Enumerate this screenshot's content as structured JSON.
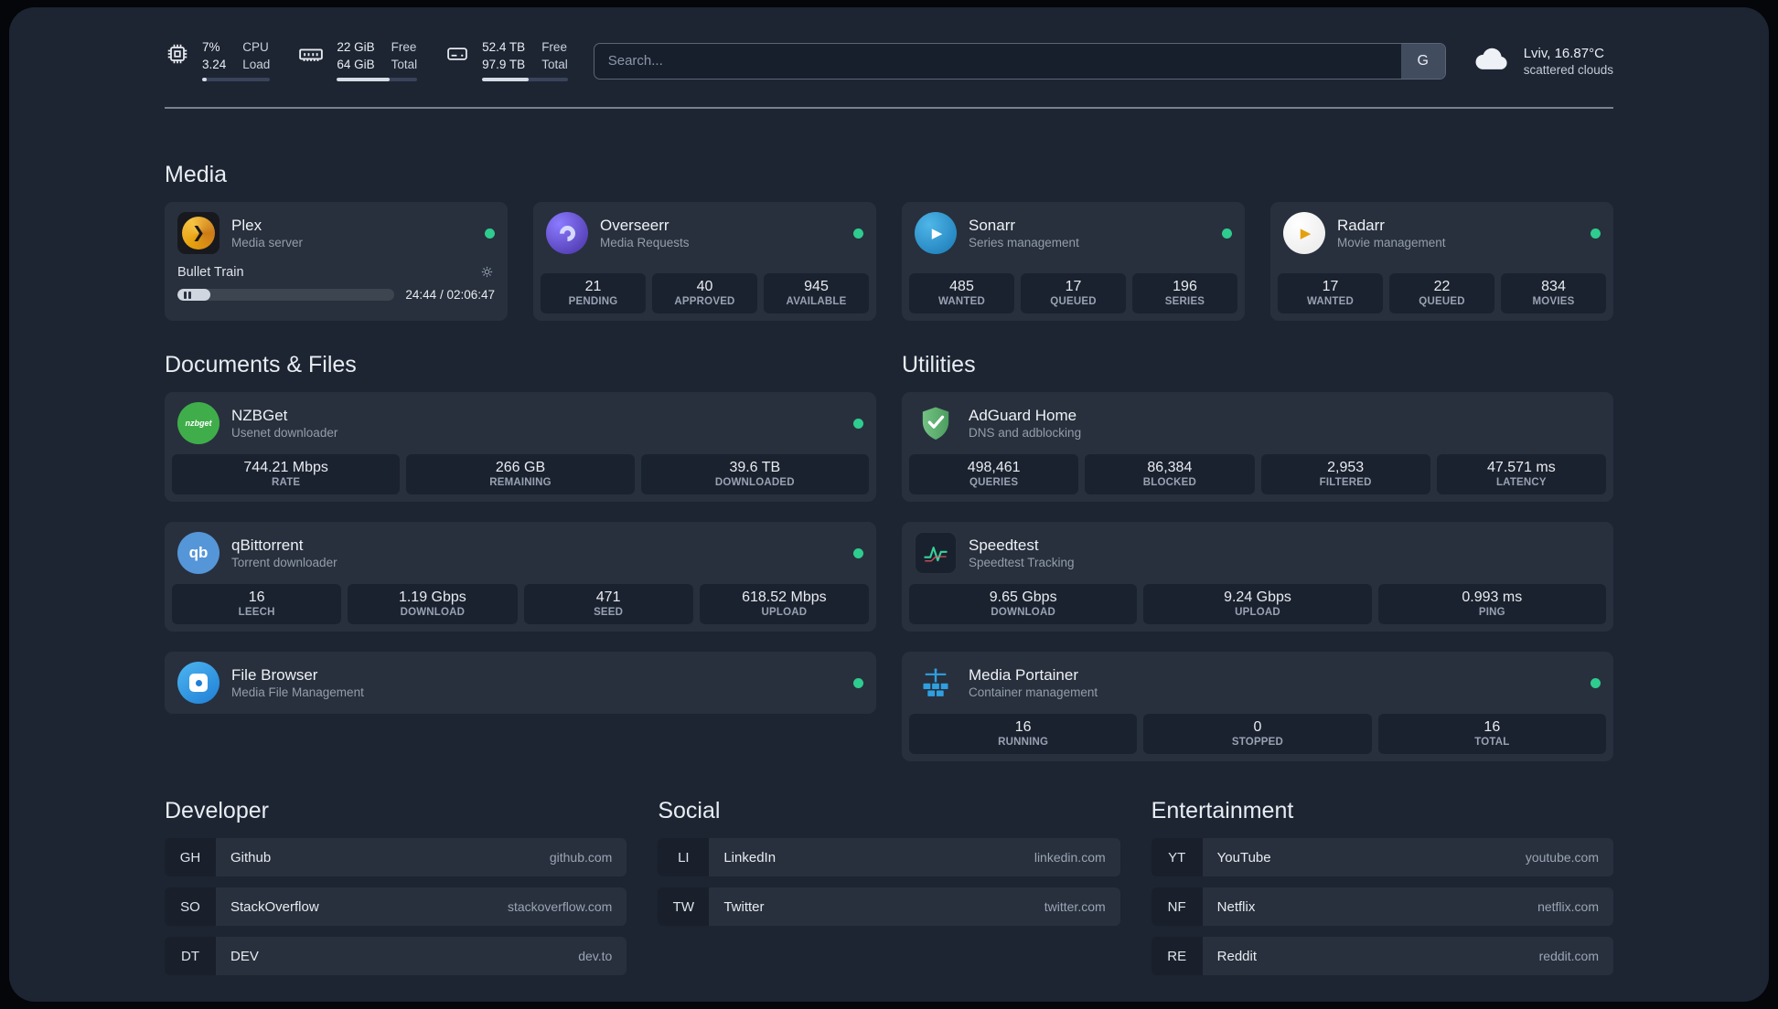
{
  "theme": {
    "background": "#1d2533",
    "card_background": "rgba(255,255,255,0.05)",
    "status_online_color": "#2ecc8f",
    "bar_fill_color": "#d7dde6",
    "text_primary": "#e9edf3",
    "text_muted": "#949dab"
  },
  "icons": {
    "plex_chevron": "❯",
    "sonarr_play": "▶",
    "radarr_play": "▶",
    "qbittorrent_glyph": "qb",
    "nzbget_glyph": "nzbget"
  },
  "topbar": {
    "cpu": {
      "value1": "7%",
      "value2": "3.24",
      "label1": "CPU",
      "label2": "Load",
      "bar_percent": 7
    },
    "memory": {
      "value1": "22 GiB",
      "value2": "64 GiB",
      "label1": "Free",
      "label2": "Total",
      "bar_percent": 66
    },
    "disk": {
      "value1": "52.4 TB",
      "value2": "97.9 TB",
      "label1": "Free",
      "label2": "Total",
      "bar_percent": 54
    },
    "search": {
      "placeholder": "Search...",
      "provider_label": "G"
    },
    "weather": {
      "location": "Lviv, 16.87°C",
      "condition": "scattered clouds"
    }
  },
  "sections": {
    "media": "Media",
    "documents": "Documents & Files",
    "utilities": "Utilities"
  },
  "services": {
    "plex": {
      "name": "Plex",
      "desc": "Media server",
      "now_playing": "Bullet Train",
      "time": "24:44 / 02:06:47",
      "progress_percent": 15
    },
    "overseerr": {
      "name": "Overseerr",
      "desc": "Media Requests",
      "stats": [
        {
          "value": "21",
          "label": "PENDING"
        },
        {
          "value": "40",
          "label": "APPROVED"
        },
        {
          "value": "945",
          "label": "AVAILABLE"
        }
      ]
    },
    "sonarr": {
      "name": "Sonarr",
      "desc": "Series management",
      "stats": [
        {
          "value": "485",
          "label": "WANTED"
        },
        {
          "value": "17",
          "label": "QUEUED"
        },
        {
          "value": "196",
          "label": "SERIES"
        }
      ]
    },
    "radarr": {
      "name": "Radarr",
      "desc": "Movie management",
      "stats": [
        {
          "value": "17",
          "label": "WANTED"
        },
        {
          "value": "22",
          "label": "QUEUED"
        },
        {
          "value": "834",
          "label": "MOVIES"
        }
      ]
    },
    "nzbget": {
      "name": "NZBGet",
      "desc": "Usenet downloader",
      "stats": [
        {
          "value": "744.21 Mbps",
          "label": "RATE"
        },
        {
          "value": "266 GB",
          "label": "REMAINING"
        },
        {
          "value": "39.6 TB",
          "label": "DOWNLOADED"
        }
      ]
    },
    "qbittorrent": {
      "name": "qBittorrent",
      "desc": "Torrent downloader",
      "stats": [
        {
          "value": "16",
          "label": "LEECH"
        },
        {
          "value": "1.19 Gbps",
          "label": "DOWNLOAD"
        },
        {
          "value": "471",
          "label": "SEED"
        },
        {
          "value": "618.52 Mbps",
          "label": "UPLOAD"
        }
      ]
    },
    "filebrowser": {
      "name": "File Browser",
      "desc": "Media File Management"
    },
    "adguard": {
      "name": "AdGuard Home",
      "desc": "DNS and adblocking",
      "stats": [
        {
          "value": "498,461",
          "label": "QUERIES"
        },
        {
          "value": "86,384",
          "label": "BLOCKED"
        },
        {
          "value": "2,953",
          "label": "FILTERED"
        },
        {
          "value": "47.571 ms",
          "label": "LATENCY"
        }
      ]
    },
    "speedtest": {
      "name": "Speedtest",
      "desc": "Speedtest Tracking",
      "stats": [
        {
          "value": "9.65 Gbps",
          "label": "DOWNLOAD"
        },
        {
          "value": "9.24 Gbps",
          "label": "UPLOAD"
        },
        {
          "value": "0.993 ms",
          "label": "PING"
        }
      ]
    },
    "portainer": {
      "name": "Media Portainer",
      "desc": "Container management",
      "stats": [
        {
          "value": "16",
          "label": "RUNNING"
        },
        {
          "value": "0",
          "label": "STOPPED"
        },
        {
          "value": "16",
          "label": "TOTAL"
        }
      ]
    }
  },
  "bookmarks": {
    "developer": {
      "title": "Developer",
      "items": [
        {
          "abbr": "GH",
          "name": "Github",
          "url": "github.com"
        },
        {
          "abbr": "SO",
          "name": "StackOverflow",
          "url": "stackoverflow.com"
        },
        {
          "abbr": "DT",
          "name": "DEV",
          "url": "dev.to"
        }
      ]
    },
    "social": {
      "title": "Social",
      "items": [
        {
          "abbr": "LI",
          "name": "LinkedIn",
          "url": "linkedin.com"
        },
        {
          "abbr": "TW",
          "name": "Twitter",
          "url": "twitter.com"
        }
      ]
    },
    "entertainment": {
      "title": "Entertainment",
      "items": [
        {
          "abbr": "YT",
          "name": "YouTube",
          "url": "youtube.com"
        },
        {
          "abbr": "NF",
          "name": "Netflix",
          "url": "netflix.com"
        },
        {
          "abbr": "RE",
          "name": "Reddit",
          "url": "reddit.com"
        }
      ]
    }
  }
}
